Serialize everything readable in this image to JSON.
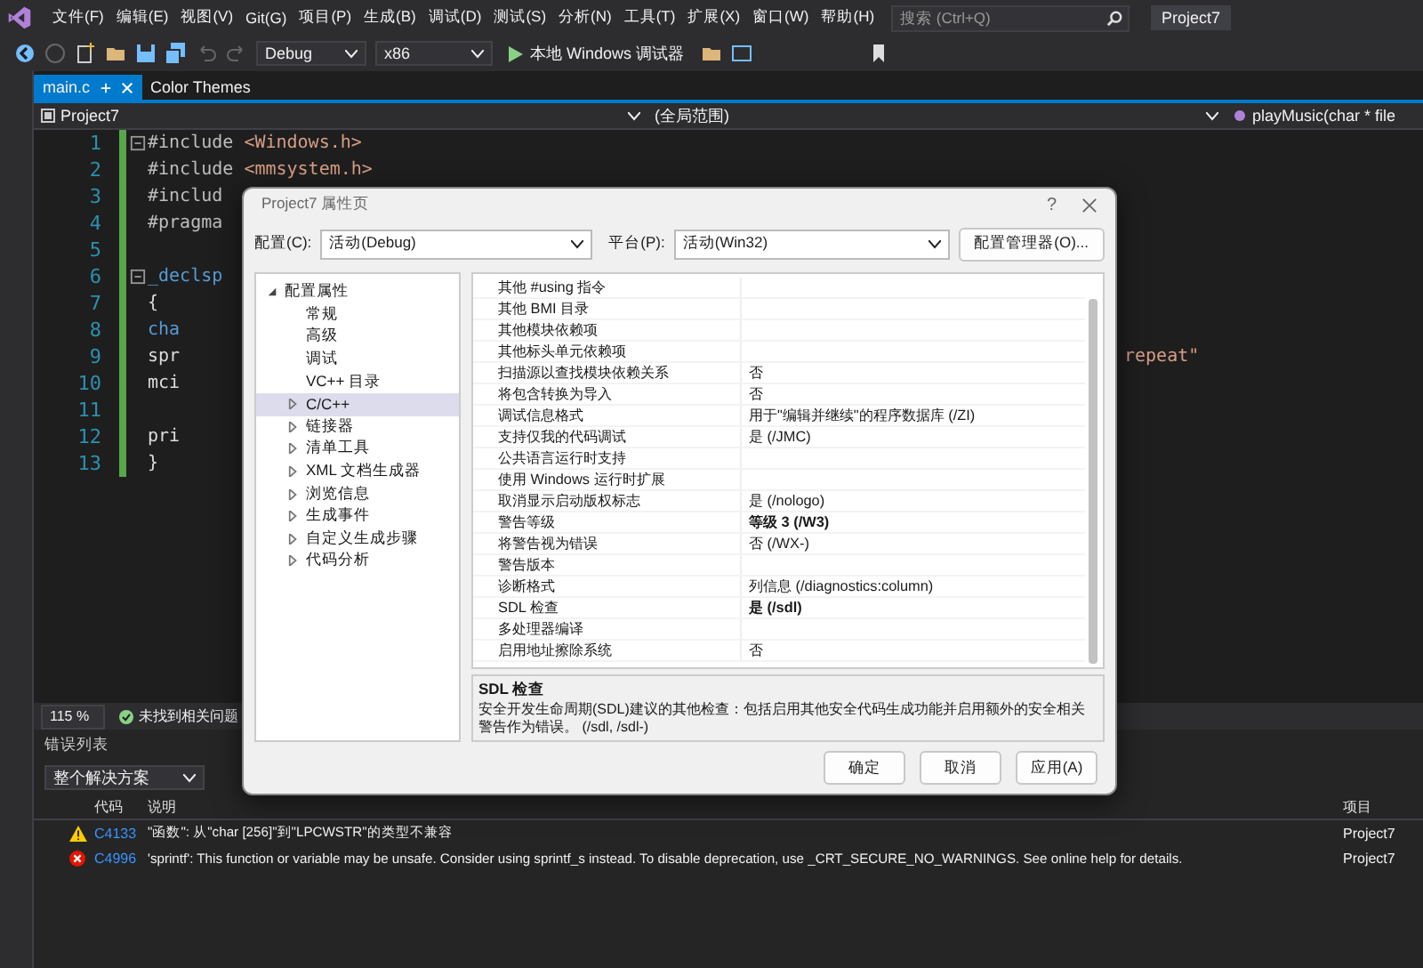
{
  "menu_bar": {
    "items": [
      "文件(F)",
      "编辑(E)",
      "视图(V)",
      "Git(G)",
      "项目(P)",
      "生成(B)",
      "调试(D)",
      "测试(S)",
      "分析(N)",
      "工具(T)",
      "扩展(X)",
      "窗口(W)",
      "帮助(H)"
    ],
    "search": {
      "placeholder": "搜索 (Ctrl+Q)"
    },
    "solution_name": "Project7"
  },
  "toolbar": {
    "configuration": "Debug",
    "platform": "x86",
    "run_button": "本地 Windows 调试器"
  },
  "tabs": [
    {
      "label": "main.c",
      "selected": true
    },
    {
      "label": "Color Themes",
      "selected": false
    }
  ],
  "nav_bar": {
    "project": "Project7",
    "scope": "(全局范围)",
    "member": "playMusic(char * file"
  },
  "editor": {
    "lines": [
      {
        "number": "1",
        "fold": true,
        "tokens": [
          {
            "kind": "directive",
            "text": "#include "
          },
          {
            "kind": "string",
            "text": "<Windows.h>"
          }
        ]
      },
      {
        "number": "2",
        "fold": false,
        "tokens": [
          {
            "kind": "directive",
            "text": "#include "
          },
          {
            "kind": "string",
            "text": "<mmsystem.h>"
          }
        ]
      },
      {
        "number": "3",
        "fold": false,
        "tokens": [
          {
            "kind": "directive",
            "text": "#includ"
          }
        ]
      },
      {
        "number": "4",
        "fold": false,
        "tokens": [
          {
            "kind": "directive",
            "text": "#pragma"
          }
        ]
      },
      {
        "number": "5",
        "fold": false
      },
      {
        "number": "6",
        "fold": true,
        "tokens": [
          {
            "kind": "keyword",
            "text": "_declsp"
          }
        ]
      },
      {
        "number": "7",
        "fold": false,
        "tokens": [
          {
            "kind": "plain",
            "text": "{"
          }
        ]
      },
      {
        "number": "8",
        "fold": false,
        "tokens": [
          {
            "kind": "keyword",
            "text": "    cha"
          }
        ]
      },
      {
        "number": "9",
        "fold": false,
        "tokens": [
          {
            "kind": "plain",
            "text": "    spr"
          }
        ],
        "tail": "repeat\""
      },
      {
        "number": "10",
        "fold": false,
        "tokens": [
          {
            "kind": "plain",
            "text": "    mci"
          }
        ]
      },
      {
        "number": "11",
        "fold": false
      },
      {
        "number": "12",
        "fold": false,
        "tokens": [
          {
            "kind": "plain",
            "text": "    pri"
          }
        ]
      },
      {
        "number": "13",
        "fold": false,
        "tokens": [
          {
            "kind": "plain",
            "text": "}"
          }
        ]
      }
    ]
  },
  "status_bar": {
    "zoom": "115 %",
    "issues": "未找到相关问题"
  },
  "error_list": {
    "title": "错误列表",
    "scope": "整个解决方案",
    "columns": [
      "代码",
      "说明",
      "项目"
    ],
    "rows": [
      {
        "kind": "warning",
        "code": "C4133",
        "description": "\"函数\": 从\"char [256]\"到\"LPCWSTR\"的类型不兼容",
        "project": "Project7"
      },
      {
        "kind": "error",
        "code": "C4996",
        "description": "'sprintf': This function or variable may be unsafe. Consider using sprintf_s instead. To disable deprecation, use _CRT_SECURE_NO_WARNINGS. See online help for details.",
        "project": "Project7"
      }
    ]
  },
  "dialog": {
    "title": "Project7 属性页",
    "help": "?",
    "config_label": "配置(C):",
    "config_value": "活动(Debug)",
    "platform_label": "平台(P):",
    "platform_value": "活动(Win32)",
    "manager_button": "配置管理器(O)...",
    "tree": [
      {
        "label": "配置属性",
        "expanded": true,
        "selected": false,
        "children": [
          {
            "label": "常规",
            "selected": false
          },
          {
            "label": "高级",
            "selected": false
          },
          {
            "label": "调试",
            "selected": false
          },
          {
            "label": "VC++ 目录",
            "selected": false
          },
          {
            "label": "C/C++",
            "selected": true,
            "expanded": false
          },
          {
            "label": "链接器",
            "selected": false,
            "expanded": false
          },
          {
            "label": "清单工具",
            "selected": false,
            "expanded": false
          },
          {
            "label": "XML 文档生成器",
            "selected": false,
            "expanded": false
          },
          {
            "label": "浏览信息",
            "selected": false,
            "expanded": false
          },
          {
            "label": "生成事件",
            "selected": false,
            "expanded": false
          },
          {
            "label": "自定义生成步骤",
            "selected": false,
            "expanded": false
          },
          {
            "label": "代码分析",
            "selected": false,
            "expanded": false
          }
        ]
      }
    ],
    "properties": [
      {
        "name": "其他 #using 指令"
      },
      {
        "name": "其他 BMI 目录"
      },
      {
        "name": "其他模块依赖项"
      },
      {
        "name": "其他标头单元依赖项"
      },
      {
        "name": "扫描源以查找模块依赖关系",
        "value": "否",
        "bold": false
      },
      {
        "name": "将包含转换为导入",
        "value": "否",
        "bold": false
      },
      {
        "name": "调试信息格式",
        "value": "用于\"编辑并继续\"的程序数据库 (/ZI)",
        "bold": false
      },
      {
        "name": "支持仅我的代码调试",
        "value": "是 (/JMC)",
        "bold": false
      },
      {
        "name": "公共语言运行时支持"
      },
      {
        "name": "使用 Windows 运行时扩展"
      },
      {
        "name": "取消显示启动版权标志",
        "value": "是 (/nologo)",
        "bold": false
      },
      {
        "name": "警告等级",
        "value": "等级 3 (/W3)",
        "bold": true
      },
      {
        "name": "将警告视为错误",
        "value": "否 (/WX-)",
        "bold": false
      },
      {
        "name": "警告版本"
      },
      {
        "name": "诊断格式",
        "value": "列信息 (/diagnostics:column)",
        "bold": false
      },
      {
        "name": "SDL 检查",
        "value": "是 (/sdl)",
        "bold": true
      },
      {
        "name": "多处理器编译"
      },
      {
        "name": "启用地址擦除系统",
        "value": "否",
        "bold": false
      }
    ],
    "description": {
      "title": "SDL 检查",
      "text": "安全开发生命周期(SDL)建议的其他检查：包括启用其他安全代码生成功能并启用额外的安全相关警告作为错误。     (/sdl, /sdl-)"
    },
    "buttons": [
      "确定",
      "取消",
      "应用(A)"
    ]
  }
}
